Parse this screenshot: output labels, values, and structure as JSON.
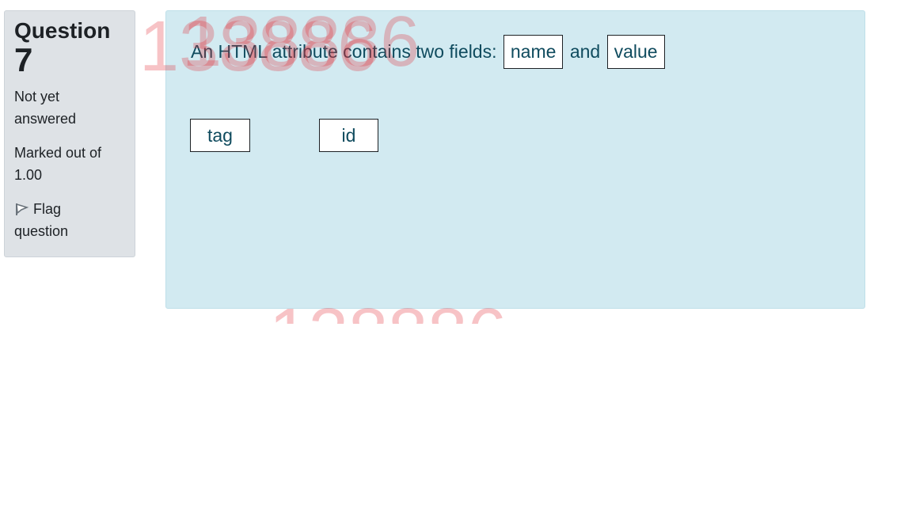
{
  "info": {
    "question_label": "Question",
    "question_number": "7",
    "state": "Not yet answered",
    "grade": "Marked out of 1.00",
    "flag_label": "Flag question",
    "flag_icon": "flag-icon"
  },
  "question": {
    "text_before": "An HTML attribute contains two fields:",
    "blank_1": "name",
    "text_between": "and",
    "blank_2": "value",
    "choices": [
      "tag",
      "id"
    ]
  },
  "watermark": {
    "text": "138886",
    "color": "#e1283247"
  },
  "colors": {
    "info_bg": "#dee2e6",
    "content_bg": "#d2eaf1",
    "content_text": "#0f4b5e"
  }
}
